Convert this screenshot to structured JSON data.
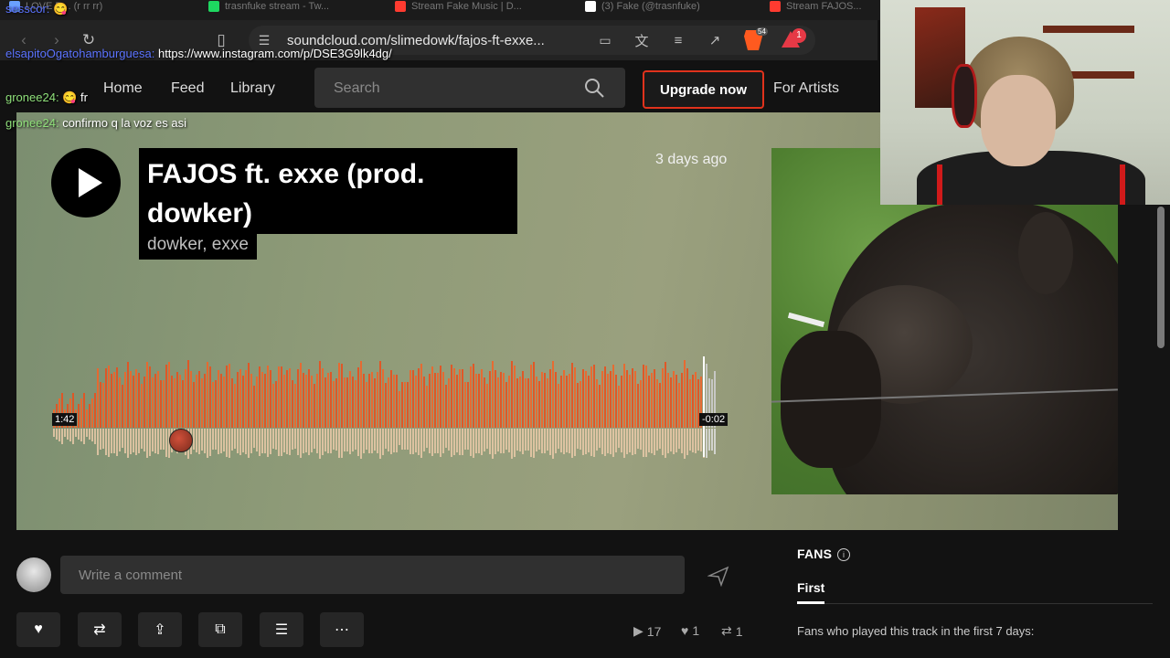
{
  "browser": {
    "tabs": [
      {
        "label": "LOVE D... (r rr rr)",
        "color": "#6aa0ff"
      },
      {
        "label": "trasnfuke stream - Tw...",
        "color": "#1ed760"
      },
      {
        "label": "Stream Fake Music | D...",
        "color": "#ff3b30"
      },
      {
        "label": "(3) Fake (@trasnfuke)",
        "color": "#ffffff"
      },
      {
        "label": "Stream FAJOS...",
        "color": "#ff3b30"
      }
    ],
    "url": "soundcloud.com/slimedowk/fajos-ft-exxe...",
    "brave_badge": "54",
    "alert_count": "1"
  },
  "chat": {
    "line1_user": "sesscor:",
    "line1_msg": "😋",
    "line2_user": "elsapitoOgatohamburguesa:",
    "line2_msg": "https://www.instagram.com/p/DSE3G9lk4dg/",
    "line3_user": "gronee24:",
    "line3_msg": "😋 fr",
    "line4_user": "gronee24:",
    "line4_msg": "confirmo q la voz es asi"
  },
  "header": {
    "nav": [
      "Home",
      "Feed",
      "Library"
    ],
    "search_placeholder": "Search",
    "upgrade": "Upgrade now",
    "for_artists": "For Artists"
  },
  "track": {
    "title": "FAJOS ft. exxe (prod. dowker)",
    "artists": "dowker, exxe",
    "posted": "3 days ago",
    "elapsed": "1:42",
    "remaining": "-0:02",
    "progress": 0.98,
    "accent": "#ff5500"
  },
  "comment": {
    "placeholder": "Write a comment"
  },
  "stats": {
    "plays": "17",
    "likes": "1",
    "reposts": "1"
  },
  "fans": {
    "title": "FANS",
    "tab": "First",
    "description": "Fans who played this track in the first 7 days:"
  }
}
